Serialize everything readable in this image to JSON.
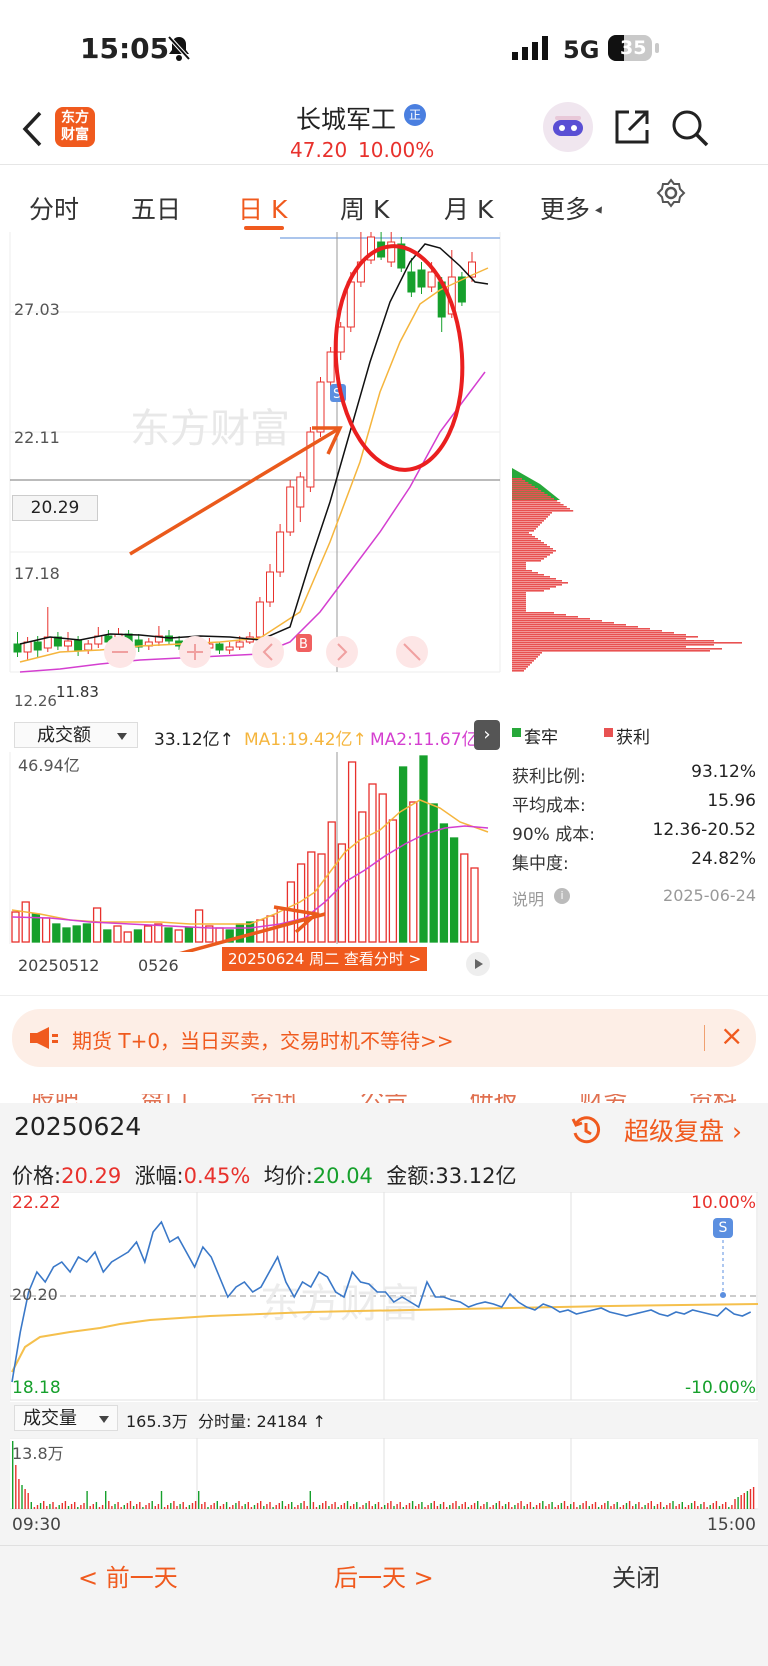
{
  "status": {
    "time": "15:05",
    "network": "5G",
    "battery": "35"
  },
  "header": {
    "logo_line1": "东方",
    "logo_line2": "财富",
    "stock_name": "长城军工",
    "badge": "正",
    "price": "47.20",
    "change_pct": "10.00%"
  },
  "tabs": [
    {
      "label": "分时"
    },
    {
      "label": "五日"
    },
    {
      "label": "日 K"
    },
    {
      "label": "周 K"
    },
    {
      "label": "月 K"
    },
    {
      "label": "更多"
    }
  ],
  "kline": {
    "price_labels": [
      "27.03",
      "22.11",
      "20.29",
      "17.18",
      "12.26",
      "11.83"
    ],
    "marker_s": "S",
    "marker_b": "B",
    "watermark": "东方财富"
  },
  "volume_bar": {
    "selector": "成交额",
    "value": "33.12亿↑",
    "ma1": "MA1:19.42亿↑",
    "ma2": "MA2:11.67亿",
    "max": "46.94亿",
    "start_date": "20250512",
    "mid_date": "0526",
    "tooltip": "20250624 周二 查看分时 >"
  },
  "chip_legend": {
    "trapped": "套牢",
    "profit": "获利"
  },
  "chip_stats": [
    {
      "label": "获利比例:",
      "value": "93.12%"
    },
    {
      "label": "平均成本:",
      "value": "15.96"
    },
    {
      "label": "90% 成本:",
      "value": "12.36-20.52"
    },
    {
      "label": "集中度:",
      "value": "24.82%"
    }
  ],
  "chip_note": {
    "label": "说明",
    "date": "2025-06-24"
  },
  "banner": {
    "text": "期货 T+0，当日买卖，交易时机不等待>>",
    "close": "×"
  },
  "hidden_tabs": [
    "股吧",
    "盘口",
    "资讯",
    "公告",
    "研报",
    "财务",
    "资料"
  ],
  "intraday": {
    "date": "20250624",
    "super_review": "超级复盘",
    "price_label": "价格:",
    "price": "20.29",
    "change_label": "涨幅:",
    "change": "0.45%",
    "avg_label": "均价:",
    "avg": "20.04",
    "amount_label": "金额:",
    "amount": "33.12亿",
    "top_price": "22.22",
    "top_pct": "10.00%",
    "mid_price": "20.20",
    "bottom_price": "18.18",
    "bottom_pct": "-10.00%",
    "vol_selector": "成交量",
    "vol_total": "165.3万",
    "vol_min_label": "分时量:",
    "vol_min": "24184 ↑",
    "vol_max": "13.8万",
    "time_start": "09:30",
    "time_end": "15:00",
    "marker_s": "S"
  },
  "footer": {
    "prev": "< 前一天",
    "next": "后一天 >",
    "close": "关闭"
  }
}
